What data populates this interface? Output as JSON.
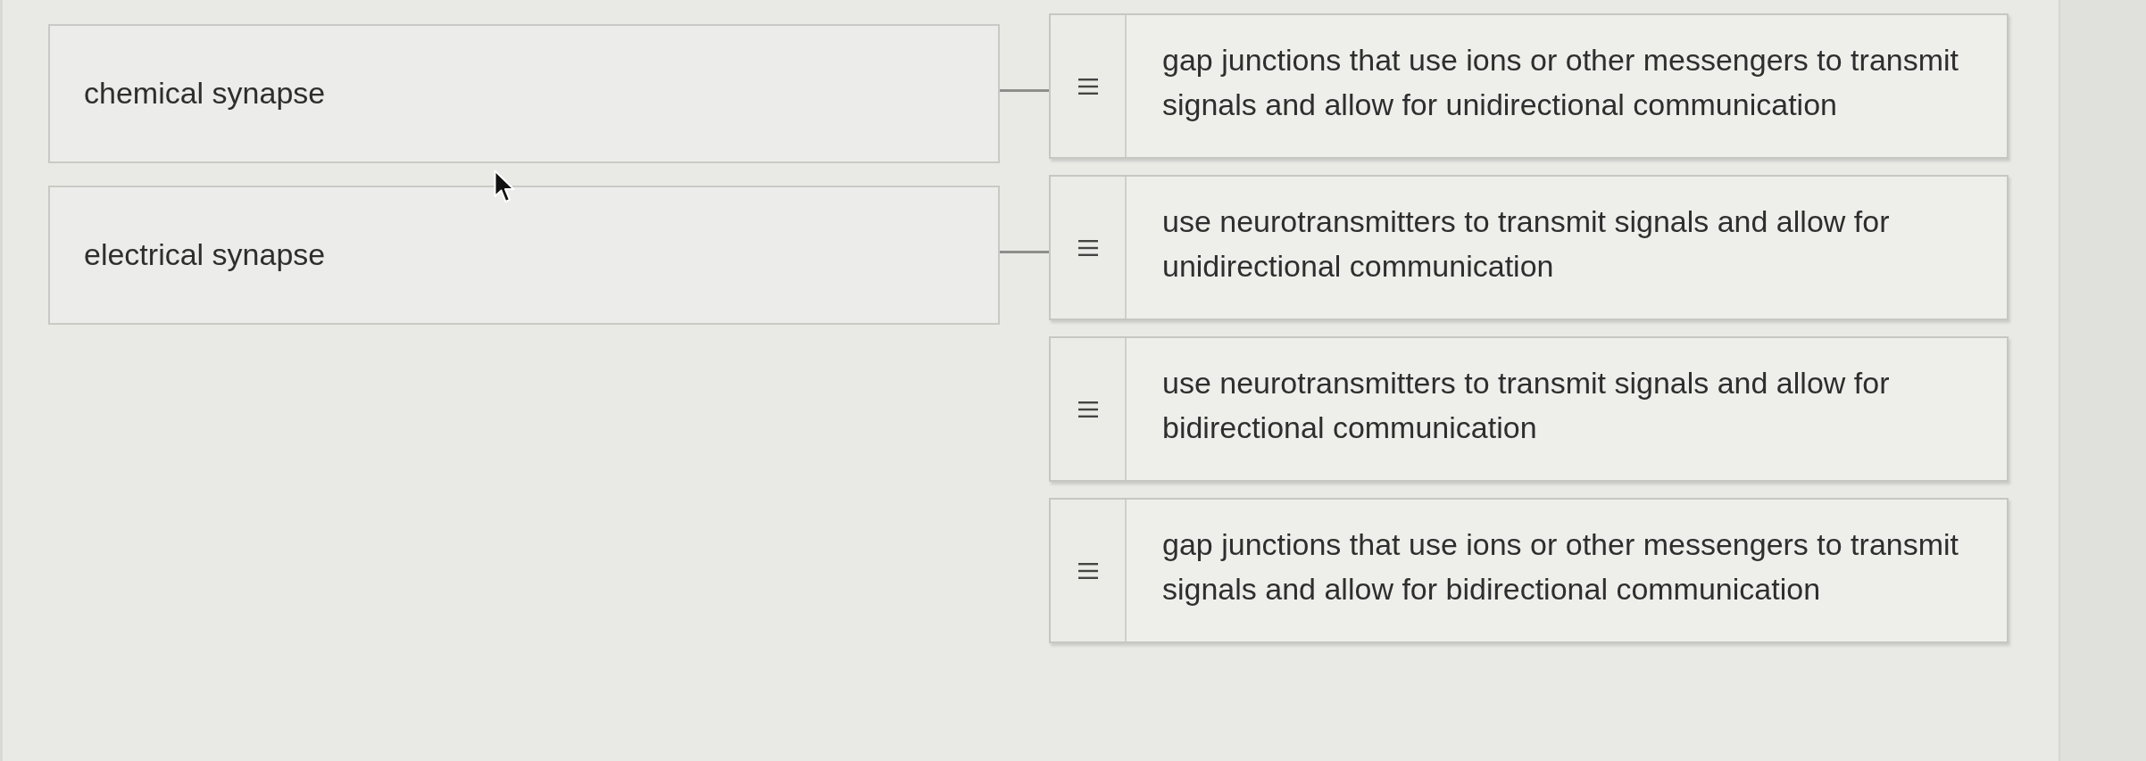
{
  "terms": [
    {
      "label": "chemical synapse",
      "connected": true
    },
    {
      "label": "electrical synapse",
      "connected": true
    }
  ],
  "answers": [
    {
      "text": "gap junctions that use ions or other messengers to transmit signals and allow for unidirectional communication"
    },
    {
      "text": "use neurotransmitters to transmit signals and allow for unidirectional communication"
    },
    {
      "text": "use neurotransmitters to transmit signals and allow for bidirectional communication"
    },
    {
      "text": "gap junctions that use ions or other messengers to transmit signals and allow for bidirectional communication"
    }
  ]
}
